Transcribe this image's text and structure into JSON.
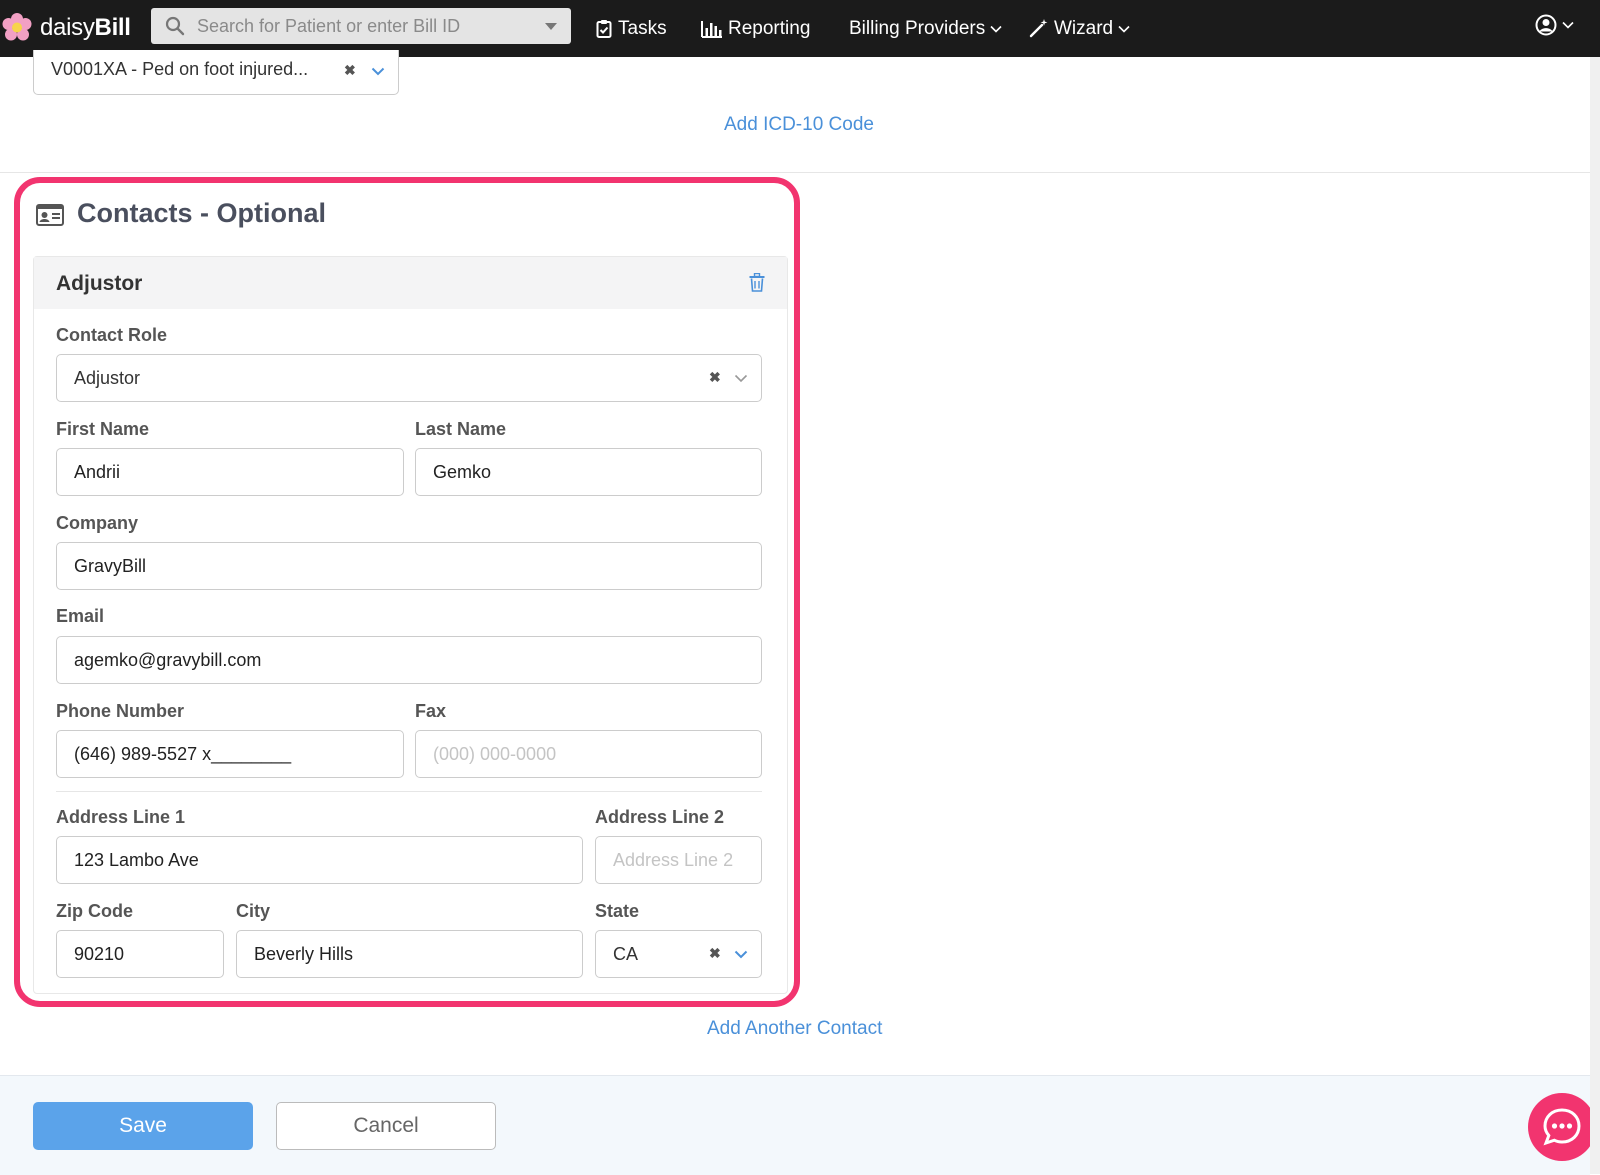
{
  "app": {
    "logo_prefix": "daisy",
    "logo_suffix": "Bill"
  },
  "search": {
    "placeholder": "Search for Patient or enter Bill ID"
  },
  "nav": {
    "tasks": "Tasks",
    "reporting": "Reporting",
    "billing_providers": "Billing Providers",
    "wizard": "Wizard"
  },
  "icd": {
    "selected": "V0001XA - Ped on foot injured...",
    "add_link": "Add ICD-10 Code"
  },
  "contacts": {
    "section_title": "Contacts - Optional",
    "card_title": "Adjustor",
    "contact_role_label": "Contact Role",
    "contact_role_value": "Adjustor",
    "first_name_label": "First Name",
    "first_name_value": "Andrii",
    "last_name_label": "Last Name",
    "last_name_value": "Gemko",
    "company_label": "Company",
    "company_value": "GravyBill",
    "email_label": "Email",
    "email_value": "agemko@gravybill.com",
    "phone_label": "Phone Number",
    "phone_value": "(646) 989-5527 x________",
    "fax_label": "Fax",
    "fax_placeholder": "(000) 000-0000",
    "address1_label": "Address Line 1",
    "address1_value": "123 Lambo Ave",
    "address2_label": "Address Line 2",
    "address2_placeholder": "Address Line 2",
    "zip_label": "Zip Code",
    "zip_value": "90210",
    "city_label": "City",
    "city_value": "Beverly Hills",
    "state_label": "State",
    "state_value": "CA",
    "add_another": "Add Another Contact"
  },
  "footer": {
    "save": "Save",
    "cancel": "Cancel"
  },
  "colors": {
    "highlight": "#f2346f",
    "link": "#4a90d9",
    "save_button": "#5ba3ea",
    "topbar": "#1b1b1b"
  }
}
